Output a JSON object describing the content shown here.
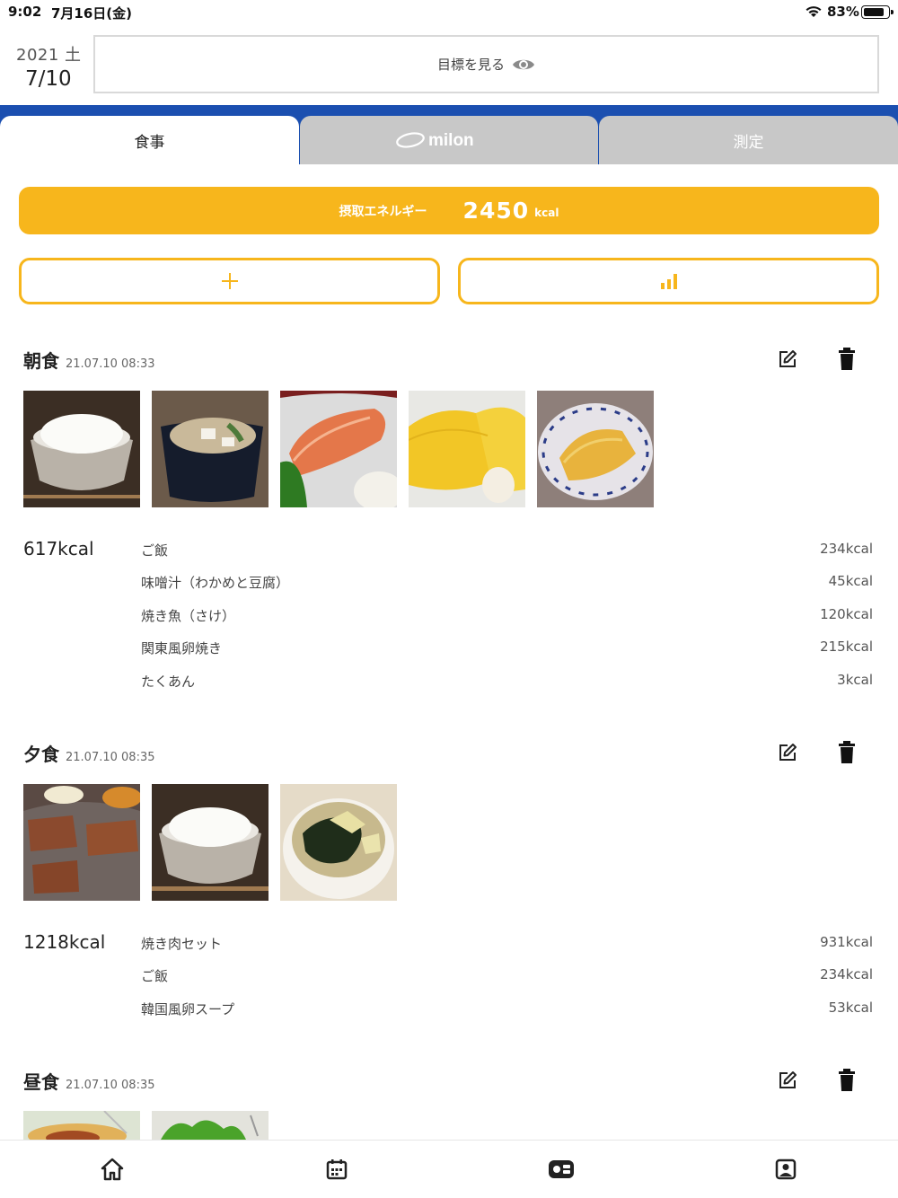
{
  "status": {
    "time": "9:02",
    "date": "7月16日(金)",
    "battery": "83%",
    "battery_level": 0.83
  },
  "header": {
    "year_day": "2021 土",
    "month_day": "7/10",
    "goal_label": "目標を見る"
  },
  "tabs": {
    "meal": "食事",
    "milon_logo": "milon",
    "measure": "測定"
  },
  "energy": {
    "label": "摂取エネルギー",
    "value": "2450",
    "unit": "kcal"
  },
  "icons": {
    "add": "plus-icon",
    "graph": "bar-chart-icon",
    "edit": "edit-icon",
    "delete": "trash-icon",
    "view": "eye-icon"
  },
  "meals": [
    {
      "name": "朝食",
      "time": "21.07.10 08:33",
      "total": "617kcal",
      "photos": [
        "rice",
        "miso-soup",
        "grilled-salmon",
        "tamagoyaki",
        "takuan"
      ],
      "items": [
        {
          "name": "ご飯",
          "kcal": "234kcal"
        },
        {
          "name": "味噌汁（わかめと豆腐）",
          "kcal": "45kcal"
        },
        {
          "name": "焼き魚（さけ）",
          "kcal": "120kcal"
        },
        {
          "name": "関東風卵焼き",
          "kcal": "215kcal"
        },
        {
          "name": "たくあん",
          "kcal": "3kcal"
        }
      ]
    },
    {
      "name": "夕食",
      "time": "21.07.10 08:35",
      "total": "1218kcal",
      "photos": [
        "yakiniku",
        "rice",
        "korean-soup"
      ],
      "items": [
        {
          "name": "焼き肉セット",
          "kcal": "931kcal"
        },
        {
          "name": "ご飯",
          "kcal": "234kcal"
        },
        {
          "name": "韓国風卵スープ",
          "kcal": "53kcal"
        }
      ]
    },
    {
      "name": "昼食",
      "time": "21.07.10 08:35",
      "photos": [
        "pasta",
        "salad"
      ]
    }
  ],
  "nav": [
    "home-icon",
    "calendar-icon",
    "meal-icon",
    "profile-icon"
  ],
  "colors": {
    "accent": "#f7b61c",
    "brand_blue": "#1b4fb0",
    "tab_inactive": "#c8c8c8"
  }
}
